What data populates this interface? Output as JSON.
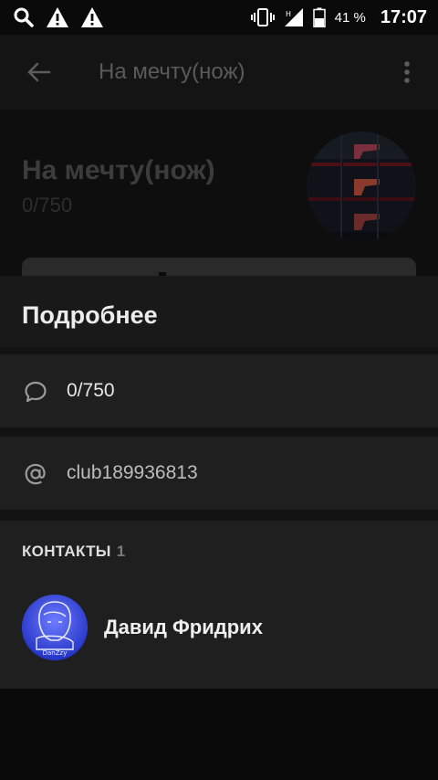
{
  "status_bar": {
    "battery_percent": "41 %",
    "time": "17:07"
  },
  "toolbar": {
    "title": "На мечту(нож)"
  },
  "group": {
    "name": "На мечту(нож)",
    "count": "0/750"
  },
  "sheet": {
    "title": "Подробнее",
    "rows": [
      {
        "icon": "comment-icon",
        "text": "0/750"
      },
      {
        "icon": "at-icon",
        "text": "club189936813"
      }
    ],
    "contacts": {
      "header": "КОНТАКТЫ",
      "count": "1",
      "items": [
        {
          "name": "Давид Фридрих",
          "avatar_caption": "DanZzy"
        }
      ]
    }
  },
  "colors": {
    "background": "#0a0a0a",
    "sheet": "#191919",
    "row": "#1f1f1f",
    "contact_avatar": "#3442d2"
  }
}
